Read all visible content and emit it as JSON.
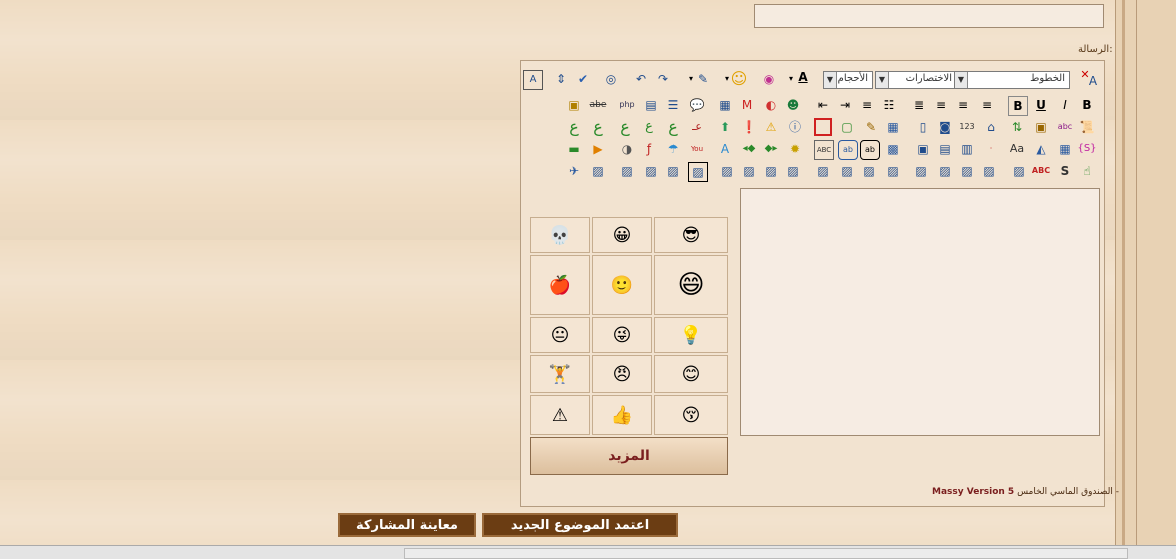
{
  "form": {
    "message_label": "الرسالة:",
    "font_select": "الخطوط",
    "size_select": "الأحجام",
    "shortcuts_select": "الاختصارات"
  },
  "smilies": {
    "more_label": "المزيد",
    "items": [
      "skull",
      "king",
      "cool-face",
      "apple",
      "smile",
      "driver",
      "idea-face",
      "wink",
      "lightbulb",
      "weights",
      "angry",
      "happy",
      "warning",
      "thumbs-up",
      "blush"
    ]
  },
  "editor_footer": {
    "arabic": "الصندوق الماسي الخامس -",
    "english": "Massy Version 5"
  },
  "buttons": {
    "submit": "اعتمد الموضوع الجديد",
    "preview": "معاينة المشاركة"
  },
  "colors": {
    "button_bg": "#6b3d13",
    "page_bg": "#efdcc3",
    "accent_red": "#7a1e1e"
  }
}
